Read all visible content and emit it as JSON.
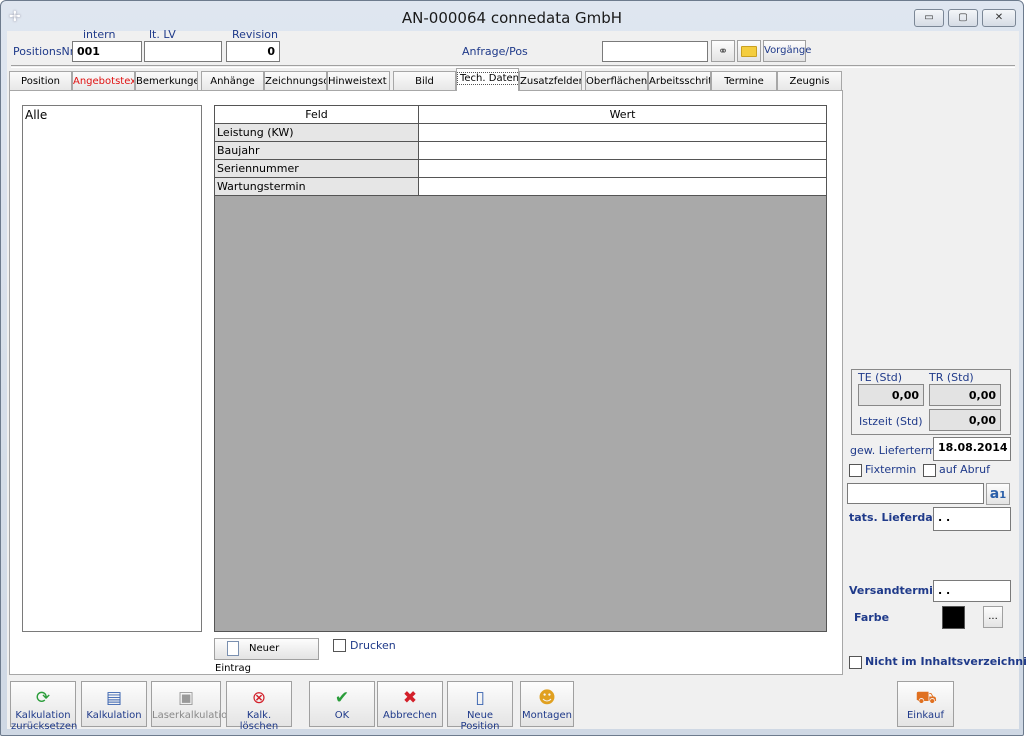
{
  "window": {
    "title": "AN-000064 connedata GmbH",
    "min": "▭",
    "max": "▢",
    "close": "✕"
  },
  "header": {
    "positions_label": "PositionsNr",
    "intern_label": "intern",
    "lv_label": "lt. LV",
    "revision_label": "Revision",
    "intern_value": "001",
    "lv_value": "",
    "revision_value": "0",
    "anfrage_label": "Anfrage/Pos",
    "anfrage_value": "",
    "vorgaenge_label": "Vorgänge"
  },
  "tabs": [
    "Position",
    "Angebotstext",
    "Bemerkungen",
    "Anhänge",
    "Zeichnungsor.",
    "Hinweistext F.",
    "Bild",
    "Tech. Daten",
    "Zusatzfelder",
    "Oberflächenbe.",
    "Arbeitsschritte",
    "Termine",
    "Zeugnis"
  ],
  "active_tab": "Tech. Daten",
  "highlight_tab_color": "#e01010",
  "list": {
    "items": [
      "Alle"
    ]
  },
  "grid": {
    "headers": [
      "Feld",
      "Wert"
    ],
    "rows": [
      {
        "feld": "Leistung (KW)",
        "wert": ""
      },
      {
        "feld": "Baujahr",
        "wert": ""
      },
      {
        "feld": "Seriennummer",
        "wert": ""
      },
      {
        "feld": "Wartungstermin",
        "wert": ""
      }
    ]
  },
  "actions": {
    "new_entry": "Neuer Eintrag",
    "print": "Drucken"
  },
  "right": {
    "te_label": "TE (Std)",
    "tr_label": "TR (Std)",
    "te_value": "0,00",
    "tr_value": "0,00",
    "istzeit_label": "Istzeit (Std)",
    "istzeit_value": "0,00",
    "gew_label": "gew. Liefertermin",
    "gew_value": "18.08.2014",
    "fixtermin": "Fixtermin",
    "auf_abruf": "auf Abruf",
    "text_value": "",
    "tats_label": "tats. Lieferdatum",
    "tats_value": ". .",
    "versand_label": "Versandtermin",
    "versand_value": ". .",
    "farbe_label": "Farbe",
    "farbe_color": "#000000",
    "farbe_more": "...",
    "nicht_label": "Nicht im Inhaltsverzeichnis anz."
  },
  "bottom": {
    "kalk_reset": "Kalkulation zurücksetzen",
    "kalk": "Kalkulation",
    "laser": "Laserkalkulation",
    "kalk_del": "Kalk. löschen",
    "ok": "OK",
    "abbrechen": "Abbrechen",
    "neue_pos": "Neue Position",
    "montagen": "Montagen",
    "einkauf": "Einkauf"
  }
}
